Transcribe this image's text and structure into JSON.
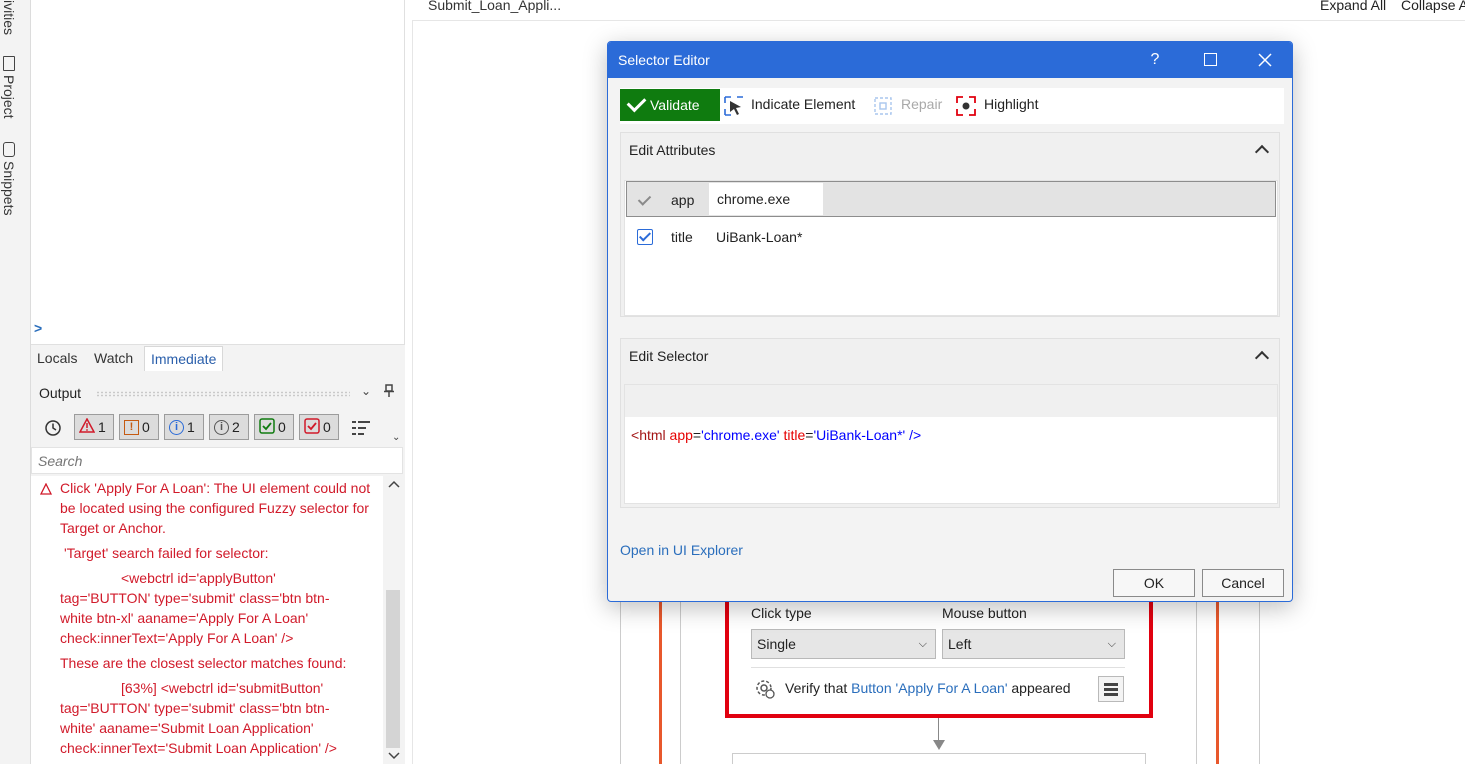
{
  "side_tabs": {
    "activities": "ivities",
    "project": "Project",
    "snippets": "Snippets"
  },
  "debug": {
    "prompt": ">",
    "tabs": [
      "Locals",
      "Watch",
      "Immediate"
    ]
  },
  "output": {
    "title": "Output",
    "filters": {
      "errors": "1",
      "warnings": "0",
      "info": "1",
      "trace": "2",
      "success": "0",
      "verbose": "0"
    },
    "search_placeholder": "Search",
    "messages": [
      "Click 'Apply For A Loan': The UI element could not be located using the configured Fuzzy selector for Target or Anchor.",
      "'Target' search failed for selector:",
      "<webctrl id='applyButton' tag='BUTTON' type='submit' class='btn btn-white btn-xl' aaname='Apply For A Loan' check:innerText='Apply For A Loan' />",
      "These are the closest selector matches found:",
      "[63%]  <webctrl id='submitButton' tag='BUTTON' type='submit' class='btn btn-white' aaname='Submit Loan Application' check:innerText='Submit Loan Application' />"
    ]
  },
  "designer": {
    "doc_tab": "Submit_Loan_Appli...",
    "expand_all": "Expand All",
    "collapse_all": "Collapse A",
    "click_type_label": "Click type",
    "click_type_value": "Single",
    "mouse_button_label": "Mouse button",
    "mouse_button_value": "Left",
    "verify_prefix": "Verify that",
    "verify_link": "Button 'Apply For A Loan'",
    "verify_suffix": "appeared"
  },
  "dialog": {
    "title": "Selector Editor",
    "help": "?",
    "toolbar": {
      "validate": "Validate",
      "indicate": "Indicate Element",
      "repair": "Repair",
      "highlight": "Highlight"
    },
    "edit_attributes": "Edit Attributes",
    "attributes": [
      {
        "name": "app",
        "value": "chrome.exe",
        "checked": true
      },
      {
        "name": "title",
        "value": "UiBank-Loan*",
        "checked": true
      }
    ],
    "edit_selector": "Edit Selector",
    "selector": {
      "open": "<",
      "tag": "html",
      "a1": "app",
      "v1": "'chrome.exe'",
      "a2": "title",
      "v2": "'UiBank-Loan*'",
      "close": "/>"
    },
    "open_in_ui_explorer": "Open in UI Explorer",
    "ok": "OK",
    "cancel": "Cancel"
  },
  "colors": {
    "accent": "#2b6bd8",
    "validate_green": "#0f7b0f",
    "error_red": "#d11a2a",
    "highlight_red": "#e1000f"
  }
}
